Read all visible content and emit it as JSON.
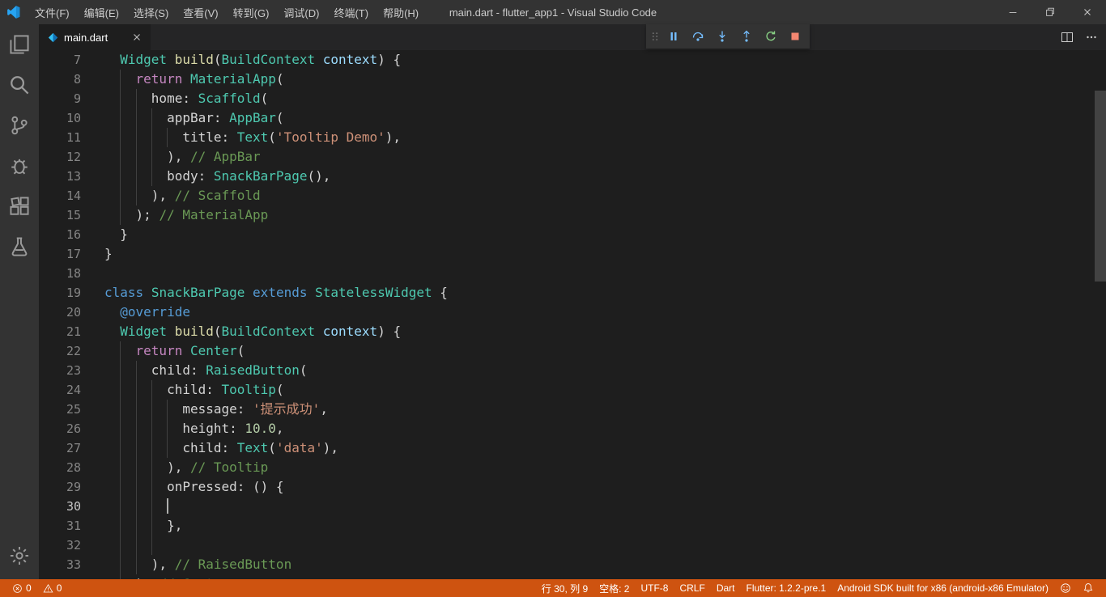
{
  "colors": {
    "titlebar_bg": "#333333",
    "activitybar_bg": "#333333",
    "tabbar_bg": "#252526",
    "editor_bg": "#1E1E1E",
    "statusbar_debugging": "#CE5310",
    "indent_guide": "#404040",
    "syntax": {
      "t": "#4EC9B0",
      "f": "#DCDCAA",
      "k": "#569CD6",
      "kc": "#C586C0",
      "p": "#D4D4D4",
      "s": "#CE9178",
      "c": "#6A9955",
      "n": "#B5CEA8",
      "a": "#569CD6",
      "v": "#9CDCFE"
    },
    "syntax_legend": {
      "t": "type",
      "f": "function",
      "k": "keyword",
      "kc": "control-keyword",
      "p": "plain-text",
      "s": "string",
      "c": "comment",
      "n": "number",
      "a": "annotation",
      "v": "parameter"
    }
  },
  "titlebar": {
    "title": "main.dart - flutter_app1 - Visual Studio Code",
    "menus": [
      {
        "id": "file",
        "label": "文件(F)"
      },
      {
        "id": "edit",
        "label": "编辑(E)"
      },
      {
        "id": "selection",
        "label": "选择(S)"
      },
      {
        "id": "view",
        "label": "查看(V)"
      },
      {
        "id": "goto",
        "label": "转到(G)"
      },
      {
        "id": "debug",
        "label": "调试(D)"
      },
      {
        "id": "terminal",
        "label": "终端(T)"
      },
      {
        "id": "help",
        "label": "帮助(H)"
      }
    ]
  },
  "activity_bar": {
    "items": [
      {
        "id": "explorer"
      },
      {
        "id": "search"
      },
      {
        "id": "source-control"
      },
      {
        "id": "debug"
      },
      {
        "id": "extensions"
      },
      {
        "id": "test"
      }
    ],
    "bottom": [
      {
        "id": "settings"
      }
    ]
  },
  "tab_bar": {
    "tabs": [
      {
        "label": "main.dart",
        "active": true
      }
    ]
  },
  "debug_toolbar": {
    "buttons": [
      {
        "id": "drag-handle"
      },
      {
        "id": "pause"
      },
      {
        "id": "step-over"
      },
      {
        "id": "step-into"
      },
      {
        "id": "step-out"
      },
      {
        "id": "restart"
      },
      {
        "id": "stop"
      }
    ]
  },
  "editor": {
    "language": "dart",
    "cursor": {
      "line": 30,
      "col": 9
    },
    "lines": [
      {
        "n": 7,
        "i": 2,
        "s": [
          [
            "Widget",
            "t"
          ],
          [
            " ",
            "p"
          ],
          [
            "build",
            "f"
          ],
          [
            "(",
            "p"
          ],
          [
            "BuildContext",
            "t"
          ],
          [
            " ",
            "p"
          ],
          [
            "context",
            "v"
          ],
          [
            ") {",
            "p"
          ]
        ]
      },
      {
        "n": 8,
        "i": 4,
        "s": [
          [
            "return",
            "kc"
          ],
          [
            " ",
            "p"
          ],
          [
            "MaterialApp",
            "t"
          ],
          [
            "(",
            "p"
          ]
        ]
      },
      {
        "n": 9,
        "i": 6,
        "s": [
          [
            "home: ",
            "p"
          ],
          [
            "Scaffold",
            "t"
          ],
          [
            "(",
            "p"
          ]
        ]
      },
      {
        "n": 10,
        "i": 8,
        "s": [
          [
            "appBar: ",
            "p"
          ],
          [
            "AppBar",
            "t"
          ],
          [
            "(",
            "p"
          ]
        ]
      },
      {
        "n": 11,
        "i": 10,
        "s": [
          [
            "title: ",
            "p"
          ],
          [
            "Text",
            "t"
          ],
          [
            "(",
            "p"
          ],
          [
            "'Tooltip Demo'",
            "s"
          ],
          [
            "),",
            "p"
          ]
        ]
      },
      {
        "n": 12,
        "i": 8,
        "s": [
          [
            "), ",
            "p"
          ],
          [
            "// AppBar",
            "c"
          ]
        ]
      },
      {
        "n": 13,
        "i": 8,
        "s": [
          [
            "body: ",
            "p"
          ],
          [
            "SnackBarPage",
            "t"
          ],
          [
            "(),",
            "p"
          ]
        ]
      },
      {
        "n": 14,
        "i": 6,
        "s": [
          [
            "), ",
            "p"
          ],
          [
            "// Scaffold",
            "c"
          ]
        ]
      },
      {
        "n": 15,
        "i": 4,
        "s": [
          [
            "); ",
            "p"
          ],
          [
            "// MaterialApp",
            "c"
          ]
        ]
      },
      {
        "n": 16,
        "i": 2,
        "s": [
          [
            "}",
            "p"
          ]
        ]
      },
      {
        "n": 17,
        "i": 0,
        "s": [
          [
            "}",
            "p"
          ]
        ]
      },
      {
        "n": 18,
        "i": 0,
        "s": []
      },
      {
        "n": 19,
        "i": 0,
        "s": [
          [
            "class",
            "k"
          ],
          [
            " ",
            "p"
          ],
          [
            "SnackBarPage",
            "t"
          ],
          [
            " ",
            "p"
          ],
          [
            "extends",
            "k"
          ],
          [
            " ",
            "p"
          ],
          [
            "StatelessWidget",
            "t"
          ],
          [
            " {",
            "p"
          ]
        ]
      },
      {
        "n": 20,
        "i": 2,
        "s": [
          [
            "@override",
            "a"
          ]
        ]
      },
      {
        "n": 21,
        "i": 2,
        "s": [
          [
            "Widget",
            "t"
          ],
          [
            " ",
            "p"
          ],
          [
            "build",
            "f"
          ],
          [
            "(",
            "p"
          ],
          [
            "BuildContext",
            "t"
          ],
          [
            " ",
            "p"
          ],
          [
            "context",
            "v"
          ],
          [
            ") {",
            "p"
          ]
        ]
      },
      {
        "n": 22,
        "i": 4,
        "s": [
          [
            "return",
            "kc"
          ],
          [
            " ",
            "p"
          ],
          [
            "Center",
            "t"
          ],
          [
            "(",
            "p"
          ]
        ]
      },
      {
        "n": 23,
        "i": 6,
        "s": [
          [
            "child: ",
            "p"
          ],
          [
            "RaisedButton",
            "t"
          ],
          [
            "(",
            "p"
          ]
        ]
      },
      {
        "n": 24,
        "i": 8,
        "s": [
          [
            "child: ",
            "p"
          ],
          [
            "Tooltip",
            "t"
          ],
          [
            "(",
            "p"
          ]
        ]
      },
      {
        "n": 25,
        "i": 10,
        "s": [
          [
            "message: ",
            "p"
          ],
          [
            "'提示成功'",
            "s"
          ],
          [
            ",",
            "p"
          ]
        ]
      },
      {
        "n": 26,
        "i": 10,
        "s": [
          [
            "height: ",
            "p"
          ],
          [
            "10.0",
            "n"
          ],
          [
            ",",
            "p"
          ]
        ]
      },
      {
        "n": 27,
        "i": 10,
        "s": [
          [
            "child: ",
            "p"
          ],
          [
            "Text",
            "t"
          ],
          [
            "(",
            "p"
          ],
          [
            "'data'",
            "s"
          ],
          [
            "),",
            "p"
          ]
        ]
      },
      {
        "n": 28,
        "i": 8,
        "s": [
          [
            "), ",
            "p"
          ],
          [
            "// Tooltip",
            "c"
          ]
        ]
      },
      {
        "n": 29,
        "i": 8,
        "s": [
          [
            "onPressed: () {",
            "p"
          ]
        ]
      },
      {
        "n": 30,
        "i": 8,
        "s": []
      },
      {
        "n": 31,
        "i": 8,
        "s": [
          [
            "},",
            "p"
          ]
        ]
      },
      {
        "n": 32,
        "i": 8,
        "s": []
      },
      {
        "n": 33,
        "i": 6,
        "s": [
          [
            "), ",
            "p"
          ],
          [
            "// RaisedButton",
            "c"
          ]
        ]
      },
      {
        "n": 34,
        "i": 4,
        "s": [
          [
            "); ",
            "p"
          ],
          [
            "// Center",
            "c"
          ]
        ]
      }
    ]
  },
  "status_bar": {
    "left": [
      {
        "id": "errors",
        "icon": "error",
        "value": "0"
      },
      {
        "id": "warnings",
        "icon": "warning",
        "value": "0"
      }
    ],
    "right": [
      {
        "id": "cursor-position",
        "label": "行 30, 列 9"
      },
      {
        "id": "indentation",
        "label": "空格: 2"
      },
      {
        "id": "encoding",
        "label": "UTF-8"
      },
      {
        "id": "eol",
        "label": "CRLF"
      },
      {
        "id": "language-mode",
        "label": "Dart"
      },
      {
        "id": "flutter-version",
        "label": "Flutter: 1.2.2-pre.1"
      },
      {
        "id": "device",
        "label": "Android SDK built for x86 (android-x86 Emulator)"
      }
    ]
  }
}
